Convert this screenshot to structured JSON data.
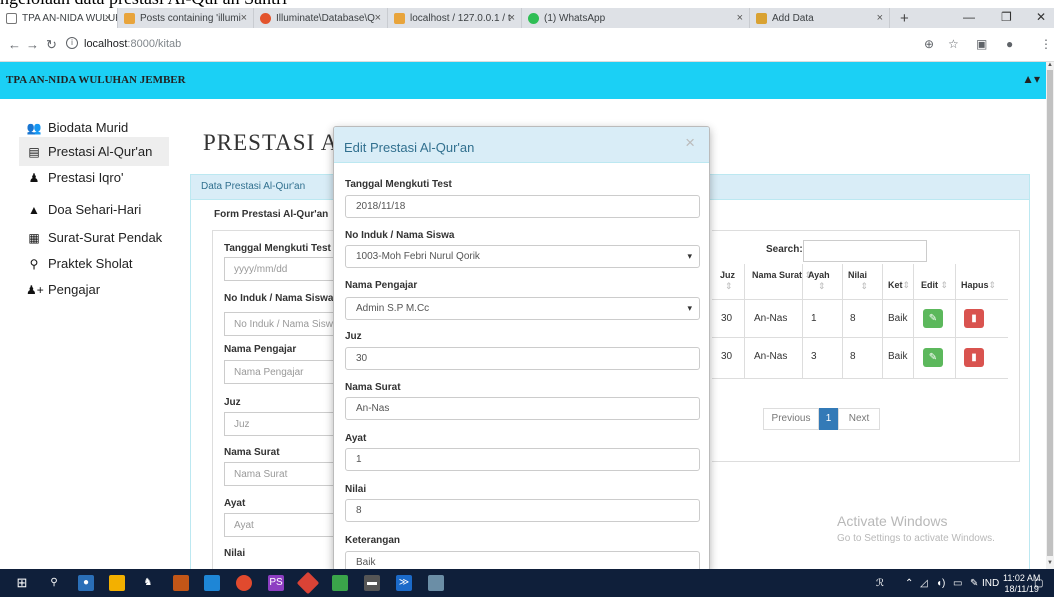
{
  "caption": "ngelolaan data prestasi Al-Qur'an Santri",
  "browser": {
    "tabs": [
      {
        "label": "TPA AN-NIDA WULUH",
        "color": "#ffffff"
      },
      {
        "label": "Posts containing 'illumi",
        "color": "#e8a43b"
      },
      {
        "label": "Illuminate\\Database\\Q",
        "color": "#e3542d"
      },
      {
        "label": "localhost / 127.0.0.1 / t",
        "color": "#e8a43b"
      },
      {
        "label": "(1) WhatsApp",
        "color": "#2fbe55"
      },
      {
        "label": "Add Data",
        "color": "#d9a232"
      }
    ],
    "url_host": "localhost",
    "url_path": ":8000/kitab"
  },
  "app": {
    "brand": "TPA AN-NIDA WULUHAN JEMBER",
    "sidebar": [
      {
        "label": "Biodata Murid",
        "icon": "users-icon"
      },
      {
        "label": "Prestasi Al-Qur'an",
        "icon": "book-icon"
      },
      {
        "label": "Prestasi Iqro'",
        "icon": "reader-icon"
      },
      {
        "label": "Doa Sehari-Hari",
        "icon": "praying-icon"
      },
      {
        "label": "Surat-Surat Pendak",
        "icon": "list-icon"
      },
      {
        "label": "Praktek Sholat",
        "icon": "prayer-icon"
      },
      {
        "label": "Pengajar",
        "icon": "user-plus-icon"
      }
    ],
    "page_title": "PRESTASI AL",
    "panel_title": "Data Prestasi Al-Qur'an",
    "form_title": "Form Prestasi Al-Qur'an",
    "form": [
      {
        "label": "Tanggal Mengkuti Test",
        "placeholder": "yyyy/mm/dd"
      },
      {
        "label": "No Induk / Nama Siswa",
        "placeholder": "No Induk / Nama Sisw"
      },
      {
        "label": "Nama Pengajar",
        "placeholder": "Nama Pengajar"
      },
      {
        "label": "Juz",
        "placeholder": "Juz"
      },
      {
        "label": "Nama Surat",
        "placeholder": "Nama Surat"
      },
      {
        "label": "Ayat",
        "placeholder": "Ayat"
      },
      {
        "label": "Nilai",
        "placeholder": ""
      }
    ],
    "table": {
      "search_label": "Search:",
      "headers": [
        "Juz",
        "Nama Surat",
        "Ayah",
        "Nilai",
        "Ket",
        "Edit",
        "Hapus"
      ],
      "rows": [
        [
          "30",
          "An-Nas",
          "1",
          "8",
          "Baik"
        ],
        [
          "30",
          "An-Nas",
          "3",
          "8",
          "Baik"
        ]
      ],
      "pager": {
        "prev": "Previous",
        "current": "1",
        "next": "Next"
      }
    },
    "watermark": {
      "line1": "Activate Windows",
      "line2": "Go to Settings to activate Windows."
    }
  },
  "modal": {
    "title": "Edit Prestasi Al-Qur'an",
    "close": "×",
    "fields": [
      {
        "label": "Tanggal Mengkuti Test",
        "value": "2018/11/18"
      },
      {
        "label": "No Induk / Nama Siswa",
        "value": "1003-Moh Febri Nurul Qorik"
      },
      {
        "label": "Nama Pengajar",
        "value": "Admin S.P M.Cc"
      },
      {
        "label": "Juz",
        "value": "30"
      },
      {
        "label": "Nama Surat",
        "value": "An-Nas"
      },
      {
        "label": "Ayat",
        "value": "1"
      },
      {
        "label": "Nilai",
        "value": "8"
      },
      {
        "label": "Keterangan",
        "value": "Baik"
      }
    ]
  },
  "taskbar": {
    "lang": "IND",
    "time": "11:02 AM",
    "date": "18/11/19"
  }
}
